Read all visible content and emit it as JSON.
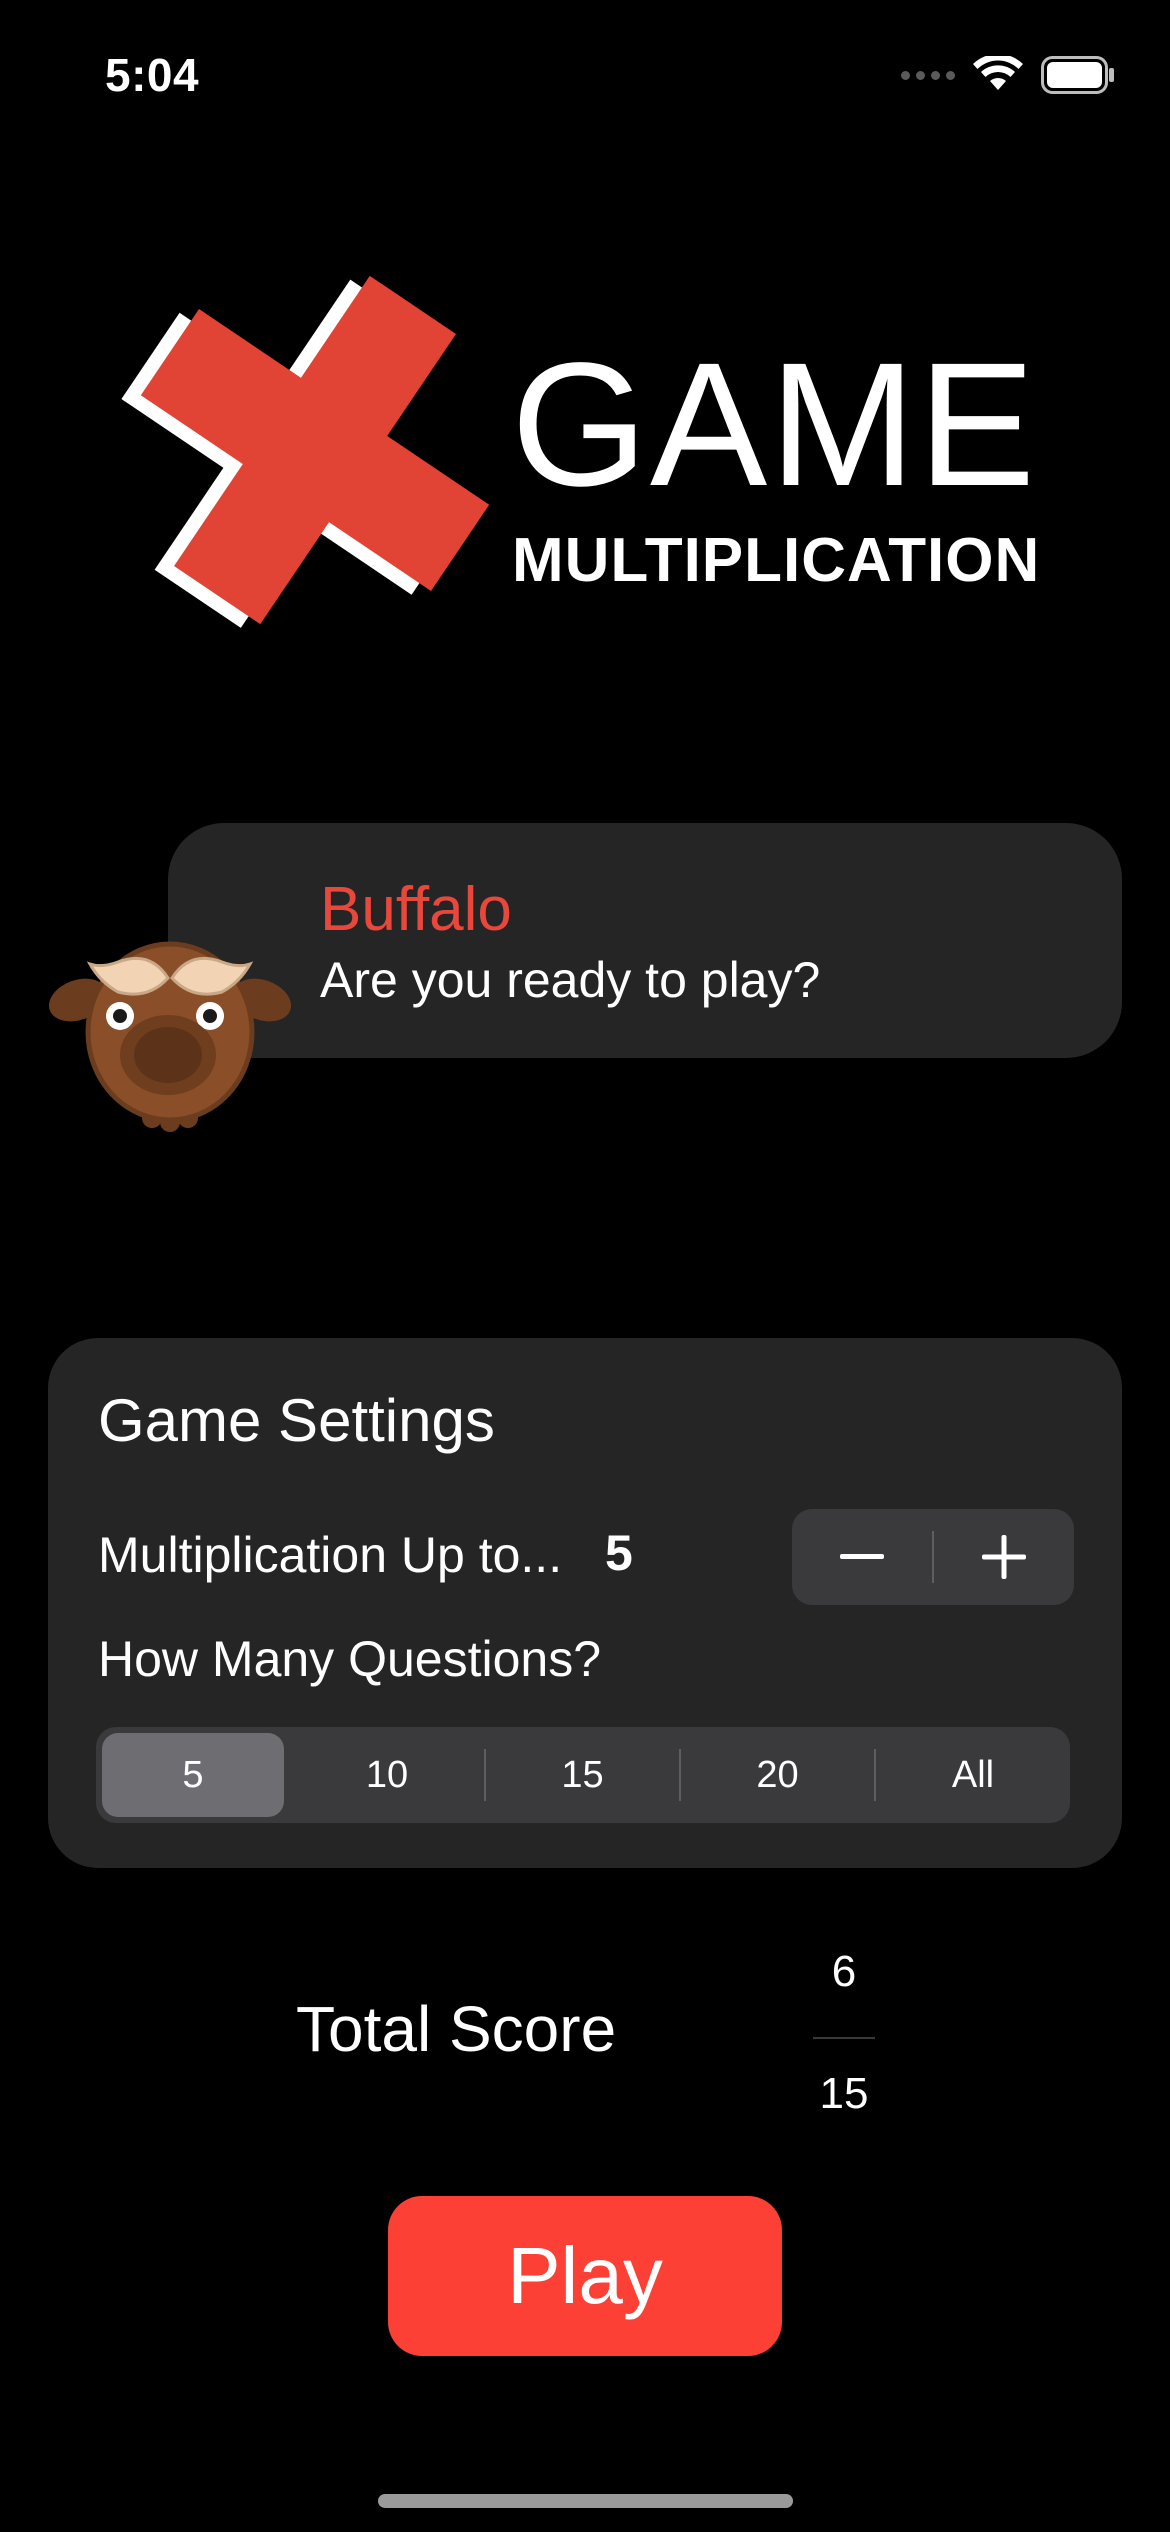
{
  "status_bar": {
    "time": "5:04",
    "icons": [
      "cellular-signal-icon",
      "wifi-icon",
      "battery-icon"
    ]
  },
  "logo": {
    "title": "GAME",
    "subtitle": "MULTIPLICATION",
    "icon": "multiplication-x-icon",
    "accent_color": "#e14434"
  },
  "character": {
    "name": "Buffalo",
    "message": "Are you ready to play?",
    "avatar": "buffalo-avatar",
    "name_color": "#e8473c"
  },
  "settings": {
    "title": "Game Settings",
    "multiplication_label": "Multiplication Up to...",
    "multiplication_value": "5",
    "stepper": {
      "decrement": "minus-icon",
      "increment": "plus-icon"
    },
    "questions_label": "How Many Questions?",
    "question_options": [
      "5",
      "10",
      "15",
      "20",
      "All"
    ],
    "selected_option": "5"
  },
  "score": {
    "label": "Total Score",
    "numerator": "6",
    "denominator": "15"
  },
  "play_button": {
    "label": "Play",
    "color": "#fd4036"
  }
}
